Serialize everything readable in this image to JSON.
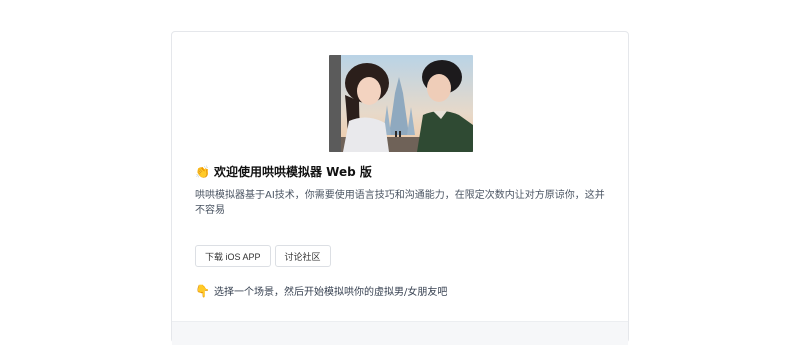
{
  "welcome": {
    "title_emoji": "👏",
    "title": "欢迎使用哄哄模拟器 Web 版",
    "description": "哄哄模拟器基于AI技术，你需要使用语言技巧和沟通能力，在限定次数内让对方原谅你，这并不容易"
  },
  "buttons": {
    "download_ios": "下载 iOS APP",
    "community": "讨论社区"
  },
  "hint": {
    "emoji": "👇",
    "text": "选择一个场景，然后开始模拟哄你的虚拟男/女朋友吧"
  },
  "hero_image": {
    "icon": "anime-couple-illustration"
  }
}
